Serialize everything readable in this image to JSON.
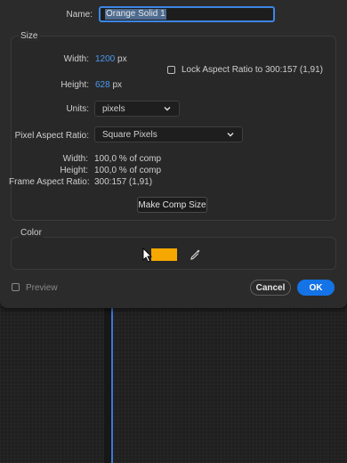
{
  "name": {
    "label": "Name:",
    "value": "Orange Solid 1"
  },
  "size": {
    "title": "Size",
    "width_label": "Width:",
    "width_value": "1200",
    "width_unit": "px",
    "height_label": "Height:",
    "height_value": "628",
    "height_unit": "px",
    "lock_label": "Lock Aspect Ratio to 300:157 (1,91)",
    "units_label": "Units:",
    "units_value": "pixels",
    "par_label": "Pixel Aspect Ratio:",
    "par_value": "Square Pixels",
    "info": {
      "width_label": "Width:",
      "width_value": "100,0 % of comp",
      "height_label": "Height:",
      "height_value": "100,0 % of comp",
      "far_label": "Frame Aspect Ratio:",
      "far_value": "300:157 (1,91)"
    },
    "make_comp_size": "Make Comp Size"
  },
  "color": {
    "title": "Color",
    "swatch_hex": "#f7a800"
  },
  "footer": {
    "preview_label": "Preview",
    "cancel_label": "Cancel",
    "ok_label": "OK"
  }
}
